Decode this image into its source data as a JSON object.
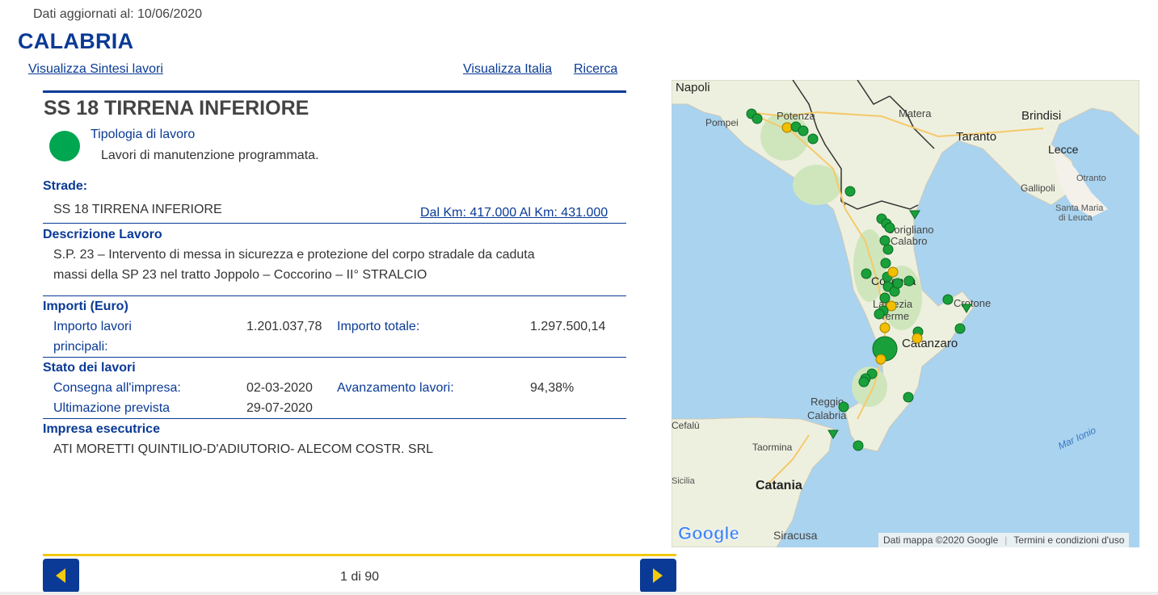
{
  "header": {
    "updated": "Dati aggiornati al: 10/06/2020",
    "region": "CALABRIA"
  },
  "links": {
    "sintesi": "Visualizza Sintesi lavori",
    "italia": "Visualizza Italia",
    "ricerca": "Ricerca"
  },
  "card": {
    "title": "SS 18 TIRRENA INFERIORE",
    "status_color": "#00a650",
    "tipologia_label": "Tipologia di lavoro",
    "tipologia_value": "Lavori di manutenzione programmata.",
    "strade_label": "Strade:",
    "strade_value": "SS 18 TIRRENA INFERIORE",
    "km_link": "Dal Km: 417.000 Al Km: 431.000",
    "descr_label": "Descrizione Lavoro",
    "descr_line1": "S.P. 23 – Intervento di messa in sicurezza e protezione del corpo stradale da caduta",
    "descr_line2": "massi della SP 23 nel tratto Joppolo – Coccorino – II° STRALCIO",
    "importi_label": "Importi (Euro)",
    "importo_lavori_label1": "Importo lavori",
    "importo_lavori_label2": "principali:",
    "importo_lavori_value": "1.201.037,78",
    "importo_totale_label": "Importo totale:",
    "importo_totale_value": "1.297.500,14",
    "stato_label": "Stato dei lavori",
    "consegna_label": "Consegna all'impresa:",
    "consegna_value": "02-03-2020",
    "avanzamento_label": "Avanzamento lavori:",
    "avanzamento_value": "94,38%",
    "ultimazione_label": "Ultimazione prevista",
    "ultimazione_value": "29-07-2020",
    "impresa_label": "Impresa esecutrice",
    "impresa_value": "ATI MORETTI QUINTILIO-D'ADIUTORIO- ALECOM COSTR. SRL"
  },
  "map": {
    "sea_color": "#a9d3ef",
    "land_color": "#f3f1ea",
    "places": [
      "Napoli",
      "Pompei",
      "Potenza",
      "Matera",
      "Brindisi",
      "Taranto",
      "Lecce",
      "Otranto",
      "Gallipoli",
      "Santa Maria",
      "di Leuca",
      "Corigliano",
      "Calabro",
      "Cosenza",
      "Lamezia",
      "Terme",
      "Crotone",
      "Catanzaro",
      "Reggio",
      "Calabria",
      "Cefalù",
      "Taormina",
      "Catania",
      "Siracusa",
      "Mar Ionio",
      "Sicilia"
    ],
    "attribution": "Dati mappa ©2020 Google",
    "terms": "Termini e condizioni d'uso",
    "logo": "Google",
    "marker_green": "#19a03a",
    "marker_yellow": "#f2be00"
  },
  "pager": {
    "count": "1 di 90",
    "prev_icon": "chevron-left-icon",
    "next_icon": "chevron-right-icon"
  }
}
